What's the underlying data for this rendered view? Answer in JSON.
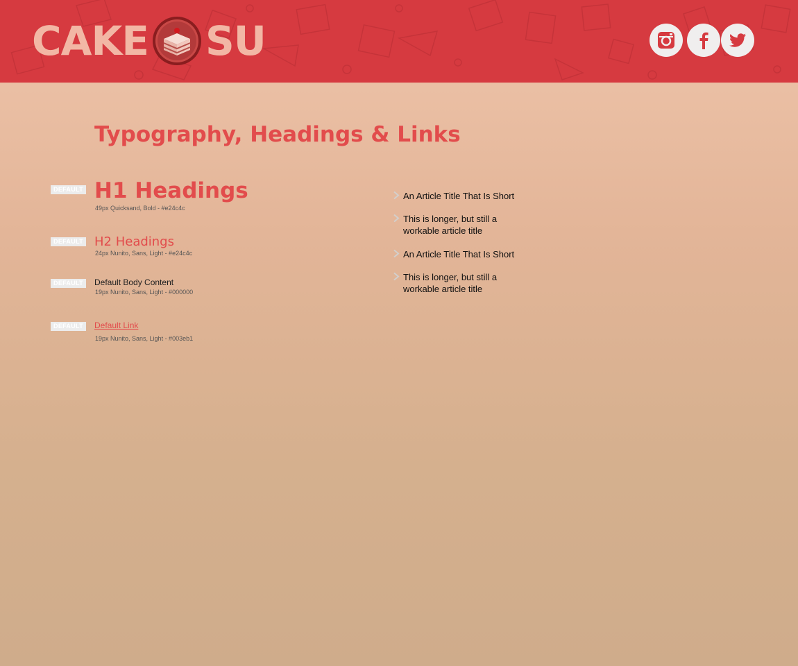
{
  "brand": {
    "name_left": "CAKE",
    "name_right": "SU",
    "accent": "#d63a40",
    "logo_color": "#f2b7a5"
  },
  "social": [
    {
      "icon": "instagram-icon"
    },
    {
      "icon": "facebook-icon"
    },
    {
      "icon": "twitter-icon"
    }
  ],
  "page_title": "Typography, Headings & Links",
  "samples": {
    "badge": "DEFAULT",
    "h1": {
      "label": "H1 Headings",
      "spec": "49px Quicksand, Bold - #e24c4c"
    },
    "h2": {
      "label": "H2 Headings",
      "spec": "24px Nunito, Sans, Light - #e24c4c"
    },
    "body": {
      "label": "Default Body Content",
      "spec": "19px Nunito, Sans, Light - #000000"
    },
    "link": {
      "label": "Default Link",
      "spec": "19px Nunito, Sans, Light - #003eb1"
    }
  },
  "articles": [
    {
      "title": "An Article Title That Is Short"
    },
    {
      "title": "This is longer, but still a workable article title"
    },
    {
      "title": "An Article Title That Is Short"
    },
    {
      "title": "This is longer, but still a workable article title"
    }
  ]
}
